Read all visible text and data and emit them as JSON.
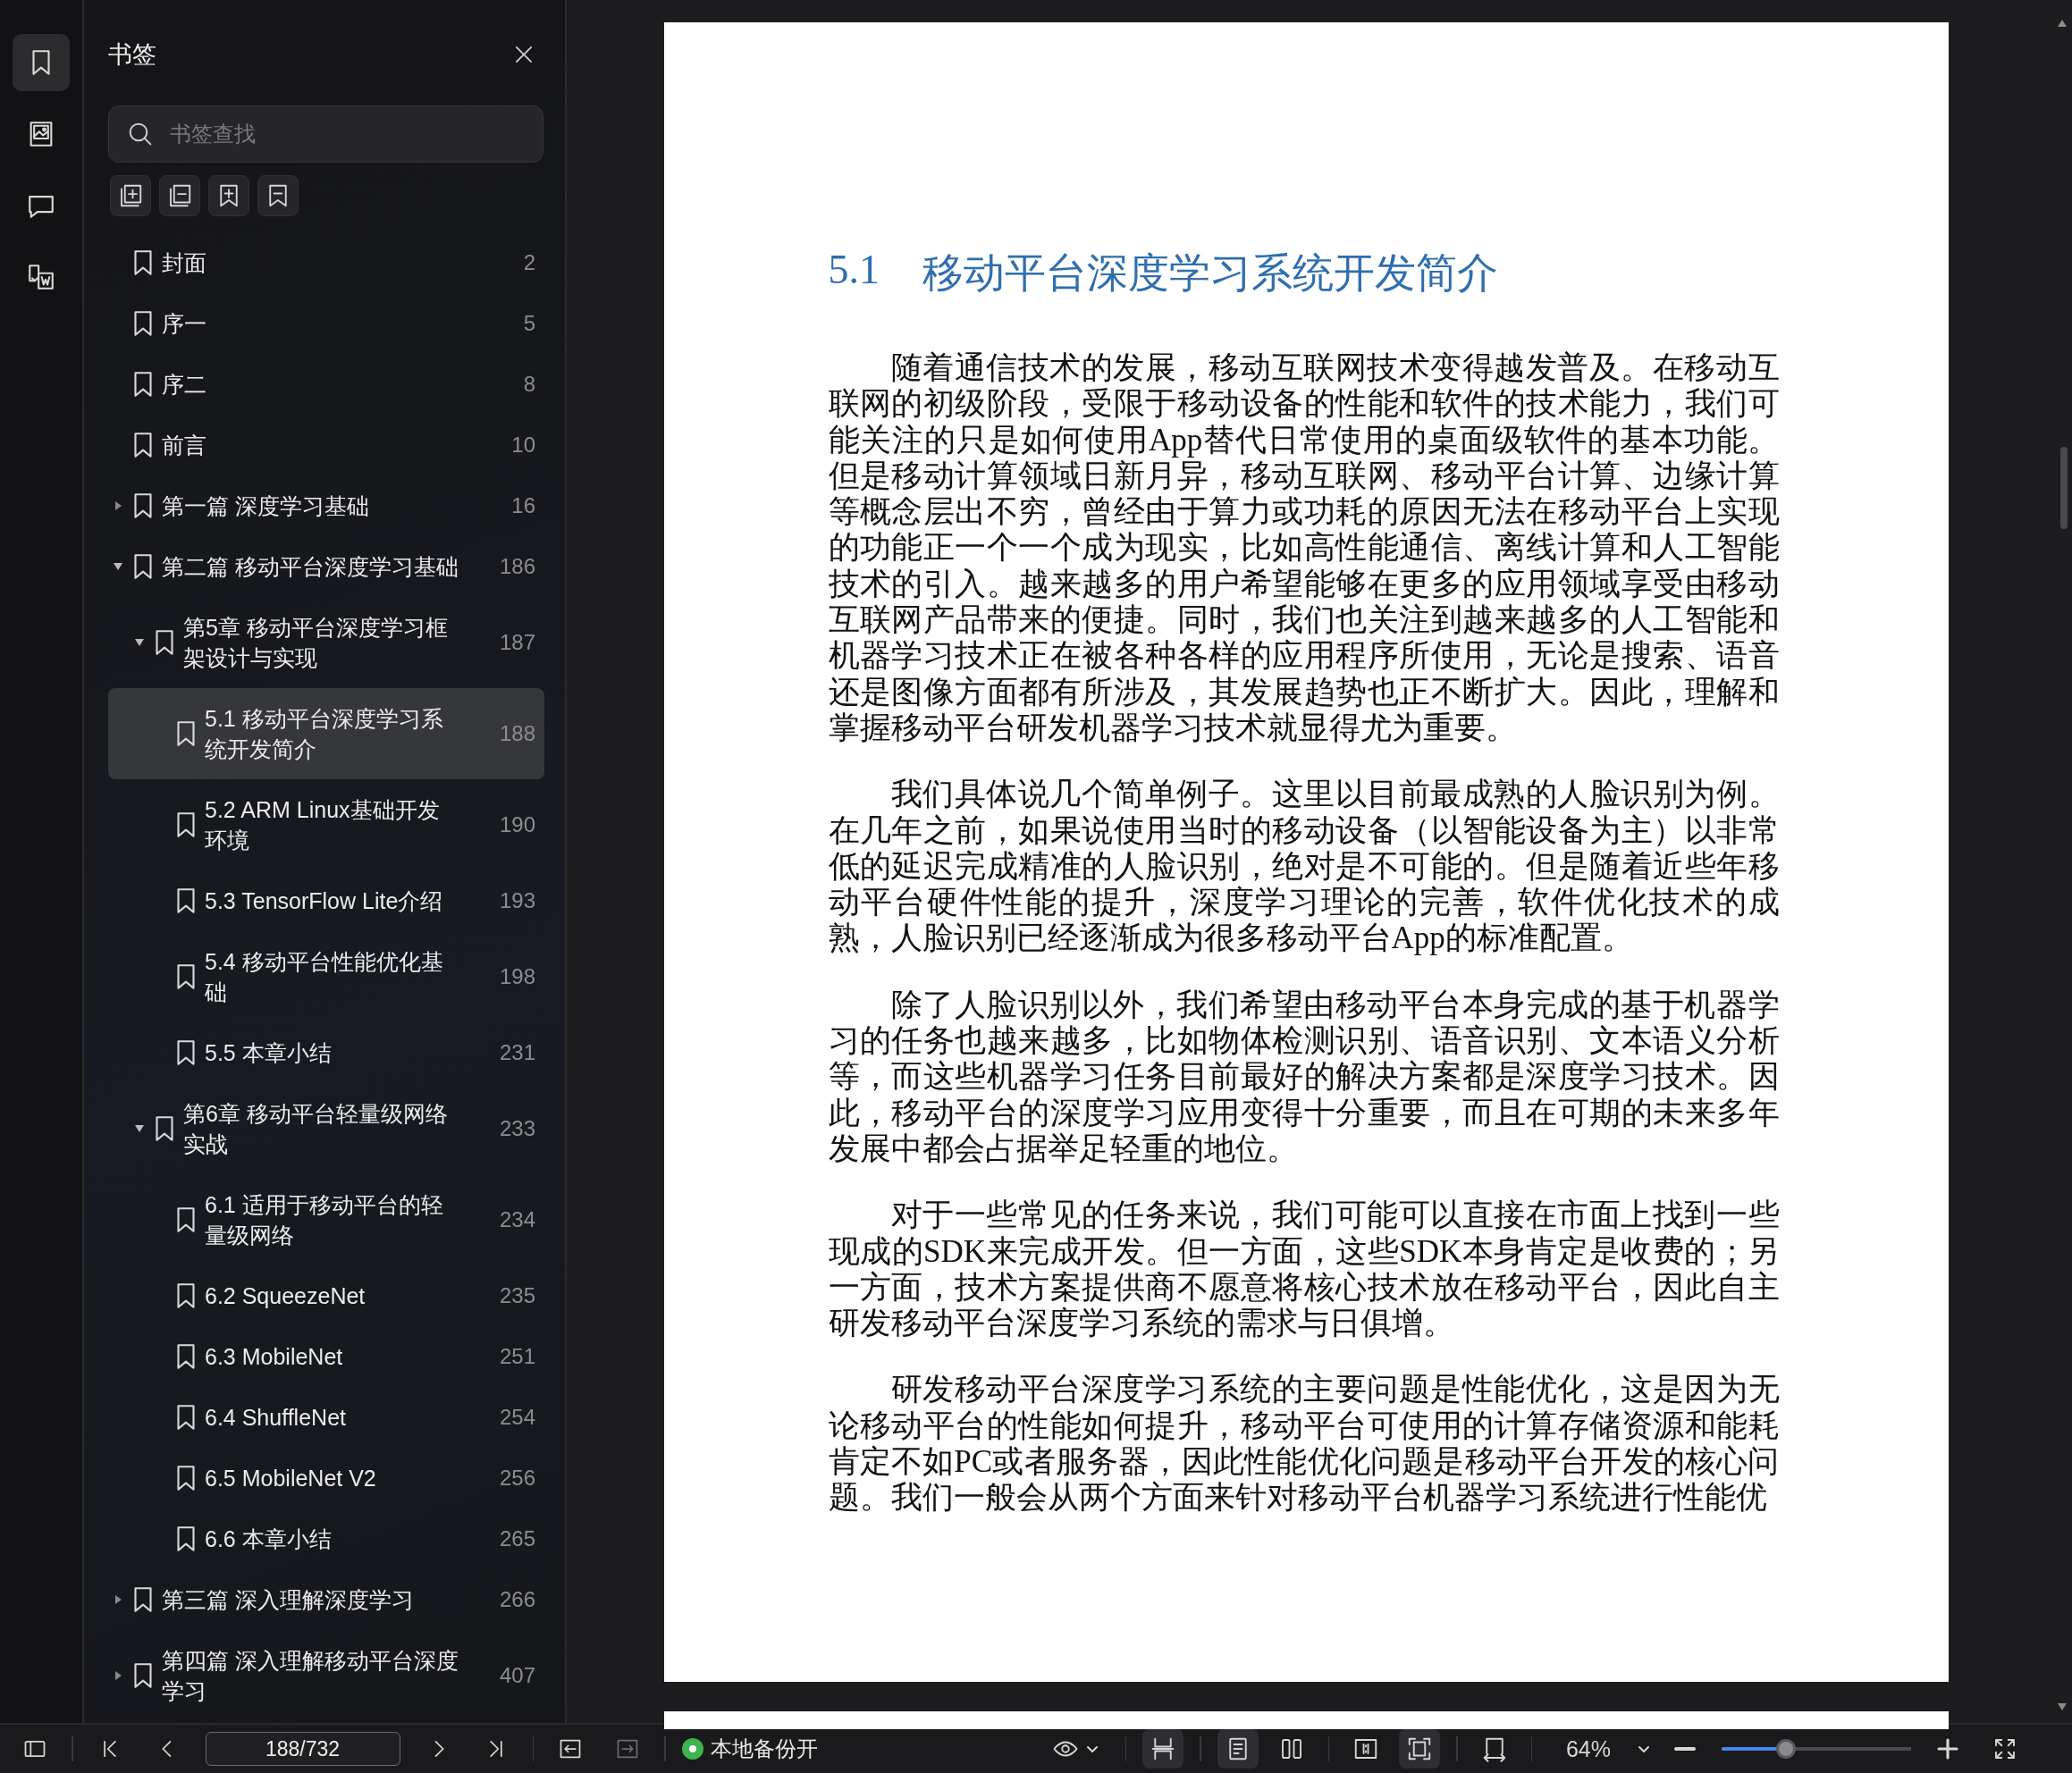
{
  "rail": {
    "tabs": [
      {
        "kind": "bookmarks",
        "selected": true
      },
      {
        "kind": "images",
        "selected": false
      },
      {
        "kind": "comments",
        "selected": false
      },
      {
        "kind": "convert",
        "selected": false
      }
    ]
  },
  "sidebar": {
    "title": "书签",
    "search": {
      "placeholder": "书签查找"
    },
    "tools": [
      {
        "kind": "expand-all"
      },
      {
        "kind": "collapse-all"
      },
      {
        "kind": "add"
      },
      {
        "kind": "remove"
      }
    ],
    "bookmarks": [
      {
        "label": "封面",
        "page": "2",
        "selected": false
      },
      {
        "label": "序一",
        "page": "5",
        "selected": false
      },
      {
        "label": "序二",
        "page": "8",
        "selected": false
      },
      {
        "label": "前言",
        "page": "10",
        "selected": false
      },
      {
        "label": "第一篇 深度学习基础",
        "page": "16",
        "expanded": false,
        "selected": false
      },
      {
        "label": "第二篇 移动平台深度学习基础",
        "page": "186",
        "expanded": true,
        "selected": false,
        "children": [
          {
            "label": "第5章 移动平台深度学习框架设计与实现",
            "page": "187",
            "expanded": true,
            "selected": false,
            "children": [
              {
                "label": "5.1 移动平台深度学习系统开发简介",
                "page": "188",
                "selected": true
              },
              {
                "label": "5.2 ARM Linux基础开发环境",
                "page": "190",
                "selected": false
              },
              {
                "label": "5.3 TensorFlow Lite介绍",
                "page": "193",
                "selected": false
              },
              {
                "label": "5.4 移动平台性能优化基础",
                "page": "198",
                "selected": false
              },
              {
                "label": "5.5 本章小结",
                "page": "231",
                "selected": false
              }
            ]
          },
          {
            "label": "第6章 移动平台轻量级网络实战",
            "page": "233",
            "expanded": true,
            "selected": false,
            "children": [
              {
                "label": "6.1 适用于移动平台的轻量级网络",
                "page": "234",
                "selected": false
              },
              {
                "label": "6.2 SqueezeNet",
                "page": "235",
                "selected": false
              },
              {
                "label": "6.3 MobileNet",
                "page": "251",
                "selected": false
              },
              {
                "label": "6.4 ShuffleNet",
                "page": "254",
                "selected": false
              },
              {
                "label": "6.5 MobileNet V2",
                "page": "256",
                "selected": false
              },
              {
                "label": "6.6 本章小结",
                "page": "265",
                "selected": false
              }
            ]
          }
        ]
      },
      {
        "label": "第三篇 深入理解深度学习",
        "page": "266",
        "expanded": false,
        "selected": false
      },
      {
        "label": "第四篇 深入理解移动平台深度学习",
        "page": "407",
        "expanded": false,
        "selected": false
      }
    ]
  },
  "document": {
    "heading_number": "5.1",
    "heading": "移动平台深度学习系统开发简介",
    "paragraphs": [
      "随着通信技术的发展，移动互联网技术变得越发普及。在移动互联网的初级阶段，受限于移动设备的性能和软件的技术能力，我们可能关注的只是如何使用App替代日常使用的桌面级软件的基本功能。但是移动计算领域日新月异，移动互联网、移动平台计算、边缘计算等概念层出不穷，曾经由于算力或功耗的原因无法在移动平台上实现的功能正一个一个成为现实，比如高性能通信、离线计算和人工智能技术的引入。越来越多的用户希望能够在更多的应用领域享受由移动互联网产品带来的便捷。同时，我们也关注到越来越多的人工智能和机器学习技术正在被各种各样的应用程序所使用，无论是搜索、语音还是图像方面都有所涉及，其发展趋势也正不断扩大。因此，理解和掌握移动平台研发机器学习技术就显得尤为重要。",
      "我们具体说几个简单例子。这里以目前最成熟的人脸识别为例。在几年之前，如果说使用当时的移动设备（以智能设备为主）以非常低的延迟完成精准的人脸识别，绝对是不可能的。但是随着近些年移动平台硬件性能的提升，深度学习理论的完善，软件优化技术的成熟，人脸识别已经逐渐成为很多移动平台App的标准配置。",
      "除了人脸识别以外，我们希望由移动平台本身完成的基于机器学习的任务也越来越多，比如物体检测识别、语音识别、文本语义分析等，而这些机器学习任务目前最好的解决方案都是深度学习技术。因此，移动平台的深度学习应用变得十分重要，而且在可期的未来多年发展中都会占据举足轻重的地位。",
      "对于一些常见的任务来说，我们可能可以直接在市面上找到一些现成的SDK来完成开发。但一方面，这些SDK本身肯定是收费的；另一方面，技术方案提供商不愿意将核心技术放在移动平台，因此自主研发移动平台深度学习系统的需求与日俱增。",
      "研发移动平台深度学习系统的主要问题是性能优化，这是因为无论移动平台的性能如何提升，移动平台可使用的计算存储资源和能耗肯定不如PC或者服务器，因此性能优化问题是移动平台开发的核心问题。我们一般会从两个方面来针对移动平台机器学习系统进行性能优"
    ]
  },
  "toolbar": {
    "nav": [
      {
        "kind": "first",
        "disabled": false
      },
      {
        "kind": "prev",
        "disabled": false
      }
    ],
    "page": "188/732",
    "nav_after": [
      {
        "kind": "next",
        "disabled": false
      },
      {
        "kind": "last",
        "disabled": false
      }
    ],
    "history": [
      {
        "kind": "back",
        "disabled": false
      },
      {
        "kind": "forward",
        "disabled": true
      }
    ],
    "backup": {
      "label": "本地备份开",
      "on": true
    },
    "view_buttons": [
      {
        "kind": "continuous",
        "selected": true
      },
      {
        "kind": "single",
        "selected": true
      },
      {
        "kind": "double",
        "selected": false
      },
      {
        "kind": "gap",
        "selected": false
      },
      {
        "kind": "fit-page",
        "selected": true
      },
      {
        "kind": "fit-width",
        "selected": false
      }
    ],
    "zoom": {
      "value": "64%",
      "level": 0.34
    }
  }
}
